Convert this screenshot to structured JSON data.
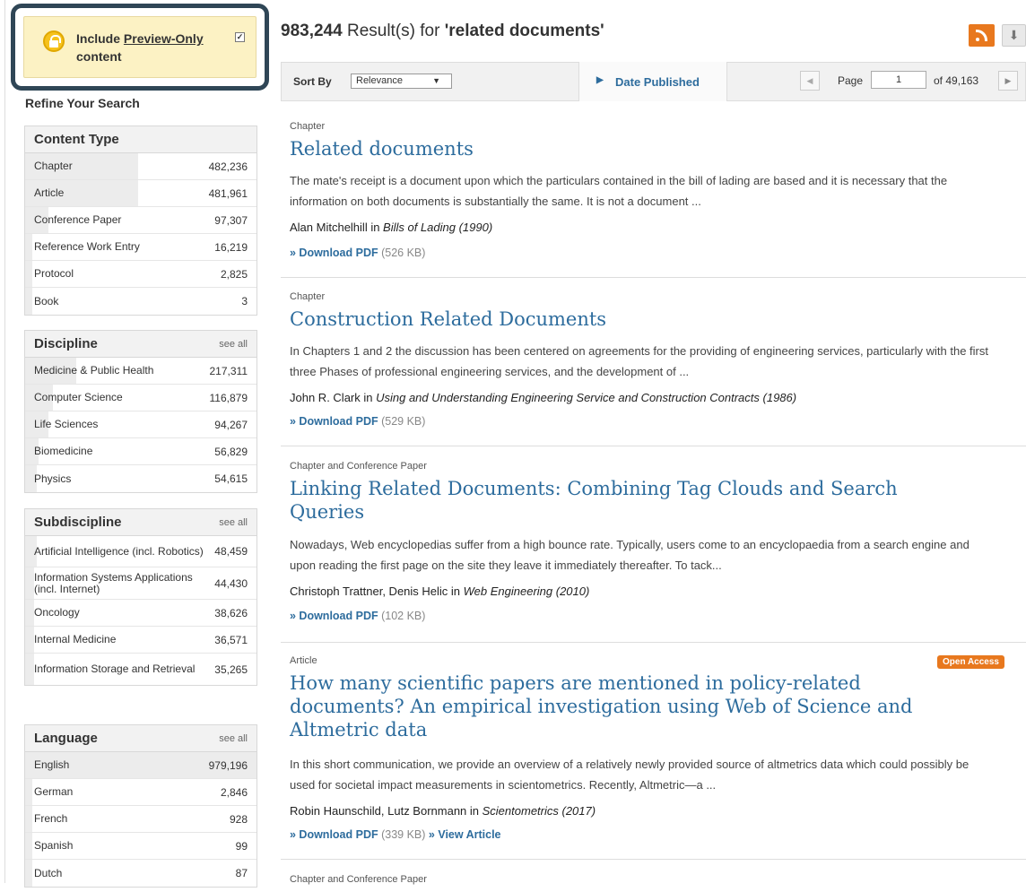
{
  "preview": {
    "text_before": "Include ",
    "link": "Preview-Only",
    "text_after": " content",
    "checked_mark": "✓"
  },
  "refine_title": "Refine Your Search",
  "facets": {
    "content_type": {
      "title": "Content Type",
      "items": [
        {
          "label": "Chapter",
          "count": "482,236",
          "fill": 0.49
        },
        {
          "label": "Article",
          "count": "481,961",
          "fill": 0.49
        },
        {
          "label": "Conference Paper",
          "count": "97,307",
          "fill": 0.1
        },
        {
          "label": "Reference Work Entry",
          "count": "16,219",
          "fill": 0.02
        },
        {
          "label": "Protocol",
          "count": "2,825",
          "fill": 0.0
        },
        {
          "label": "Book",
          "count": "3",
          "fill": 0.0
        }
      ]
    },
    "discipline": {
      "title": "Discipline",
      "see_all": "see all",
      "items": [
        {
          "label": "Medicine & Public Health",
          "count": "217,311",
          "fill": 0.22
        },
        {
          "label": "Computer Science",
          "count": "116,879",
          "fill": 0.12
        },
        {
          "label": "Life Sciences",
          "count": "94,267",
          "fill": 0.1
        },
        {
          "label": "Biomedicine",
          "count": "56,829",
          "fill": 0.06
        },
        {
          "label": "Physics",
          "count": "54,615",
          "fill": 0.05
        }
      ]
    },
    "subdiscipline": {
      "title": "Subdiscipline",
      "see_all": "see all",
      "items": [
        {
          "label": "Artificial Intelligence (incl. Robotics)",
          "count": "48,459",
          "fill": 0.05
        },
        {
          "label": "Information Systems Applications (incl. Internet)",
          "count": "44,430",
          "fill": 0.04
        },
        {
          "label": "Oncology",
          "count": "38,626",
          "fill": 0.04
        },
        {
          "label": "Internal Medicine",
          "count": "36,571",
          "fill": 0.04
        },
        {
          "label": "Information Storage and Retrieval",
          "count": "35,265",
          "fill": 0.04
        }
      ]
    },
    "language": {
      "title": "Language",
      "see_all": "see all",
      "items": [
        {
          "label": "English",
          "count": "979,196",
          "fill": 1.0
        },
        {
          "label": "German",
          "count": "2,846",
          "fill": 0.0
        },
        {
          "label": "French",
          "count": "928",
          "fill": 0.0
        },
        {
          "label": "Spanish",
          "count": "99",
          "fill": 0.0
        },
        {
          "label": "Dutch",
          "count": "87",
          "fill": 0.0
        }
      ]
    }
  },
  "results_header": {
    "count": "983,244",
    "text": " Result(s) for ",
    "query": "'related documents'"
  },
  "icons": {
    "rss": "rss-icon",
    "download": "download-icon"
  },
  "toolbar": {
    "sort_label": "Sort By",
    "sort_value": "Relevance",
    "date_tab": "Date Published",
    "page_label": "Page",
    "page_value": "1",
    "page_of": "of 49,163"
  },
  "results": [
    {
      "type": "Chapter",
      "title": "Related documents",
      "snippet": "The mate's receipt is a document upon which the particulars contained in the bill of lading are based and it is necessary that the information on both documents is substantially the same. It is not a document ...",
      "authors": "Alan Mitchelhill in ",
      "source": "Bills of Lading (1990)",
      "download": "» Download PDF",
      "size": " (526 KB)"
    },
    {
      "type": "Chapter",
      "title": "Construction Related Documents",
      "snippet": "In Chapters 1 and 2 the discussion has been centered on agreements for the providing of engineering services, particularly with the first three Phases of professional engineering services, and the development of ...",
      "authors": "John R. Clark in ",
      "source": "Using and Understanding Engineering Service and Construction Contracts (1986)",
      "download": "» Download PDF",
      "size": " (529 KB)"
    },
    {
      "type": "Chapter and Conference Paper",
      "title": "Linking Related Documents: Combining Tag Clouds and Search Queries",
      "snippet": "Nowadays, Web encyclopedias suffer from a high bounce rate. Typically, users come to an encyclopaedia from a search engine and upon reading the first page on the site they leave it immediately thereafter. To tack...",
      "authors": "Christoph Trattner, Denis Helic in ",
      "source": "Web Engineering (2010)",
      "download": "» Download PDF",
      "size": " (102 KB)"
    },
    {
      "type": "Article",
      "badge": "Open Access",
      "title": "How many scientific papers are mentioned in policy-related documents? An empirical investigation using Web of Science and Altmetric data",
      "snippet": "In this short communication, we provide an overview of a relatively newly provided source of altmetrics data which could possibly be used for societal impact measurements in scientometrics. Recently, Altmetric—a ...",
      "authors": "Robin Haunschild, Lutz Bornmann in ",
      "source": "Scientometrics (2017)",
      "download": "» Download PDF",
      "size": " (339 KB)",
      "view": " » View Article"
    },
    {
      "type": "Chapter and Conference Paper"
    }
  ]
}
